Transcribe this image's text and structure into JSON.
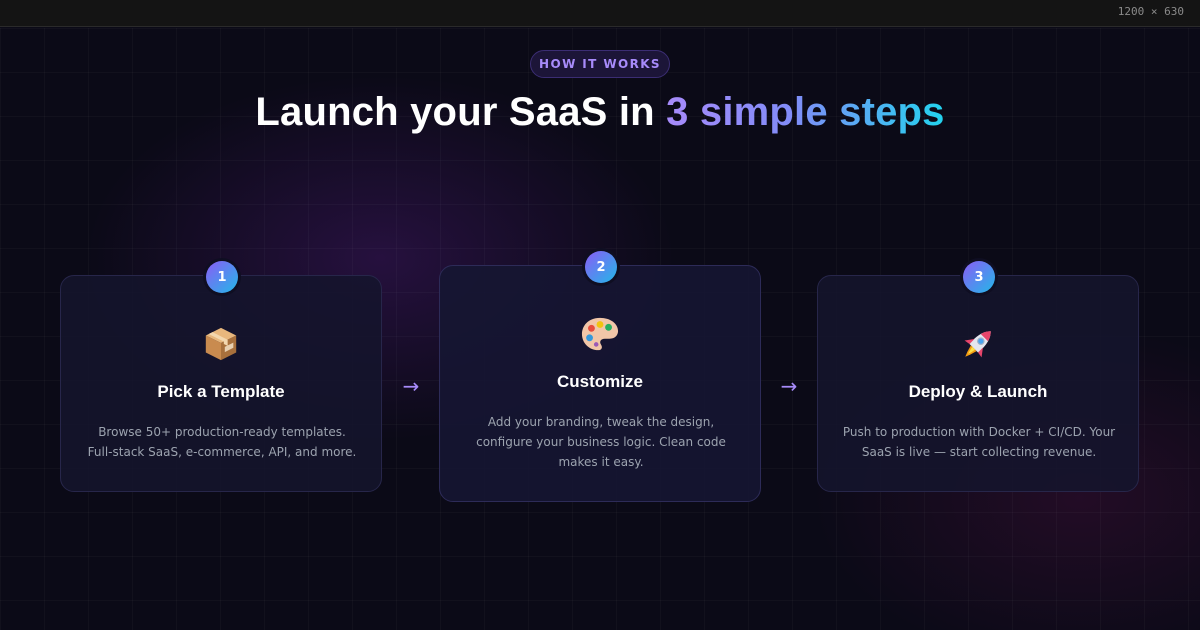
{
  "window": {
    "size_label": "1200 × 630"
  },
  "section": {
    "badge": "HOW IT WORKS",
    "headline_prefix": "Launch your SaaS in ",
    "headline_accent": "3 simple steps"
  },
  "steps": [
    {
      "number": "1",
      "icon": "package-icon",
      "title": "Pick a Template",
      "description": "Browse 50+ production-ready templates. Full-stack SaaS, e-commerce, API, and more."
    },
    {
      "number": "2",
      "icon": "palette-icon",
      "title": "Customize",
      "description": "Add your branding, tweak the design, configure your business logic. Clean code makes it easy."
    },
    {
      "number": "3",
      "icon": "rocket-icon",
      "title": "Deploy & Launch",
      "description": "Push to production with Docker + CI/CD. Your SaaS is live — start collecting revenue."
    }
  ],
  "arrow_glyph": "→",
  "colors": {
    "background": "#0b0a17",
    "card": "#14142c",
    "accent_purple": "#a78bfa",
    "accent_cyan": "#22d3ee"
  }
}
